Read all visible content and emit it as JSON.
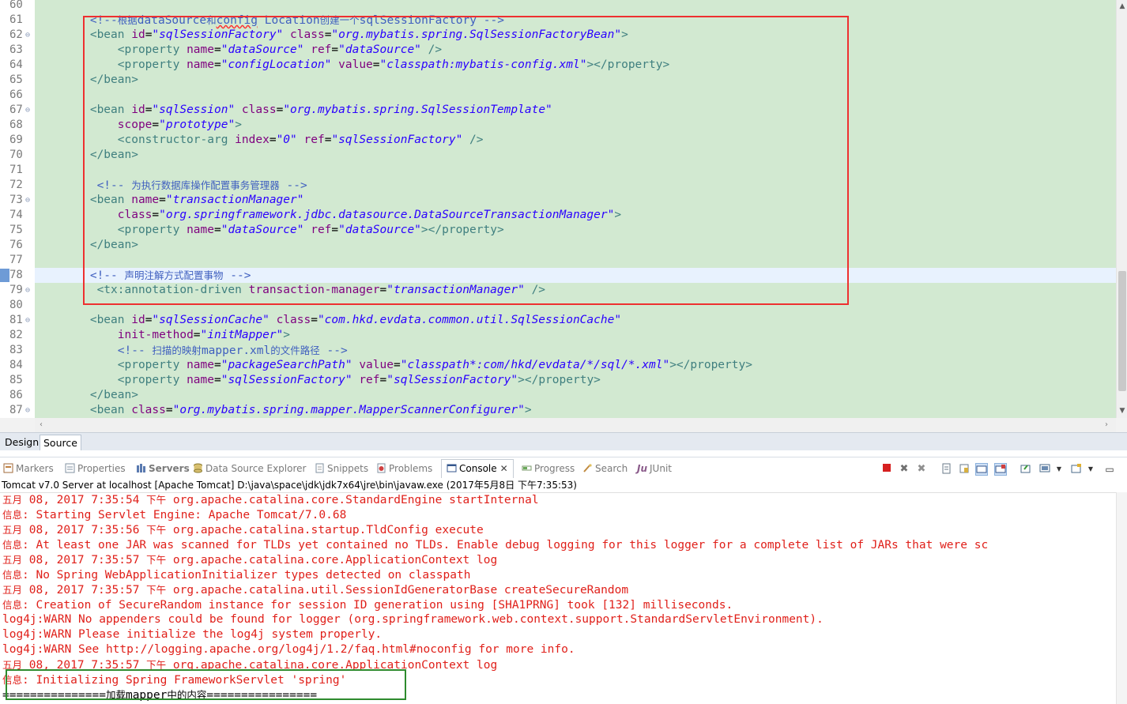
{
  "editor": {
    "gutter": [
      {
        "num": "60",
        "fold": ""
      },
      {
        "num": "61",
        "fold": ""
      },
      {
        "num": "62",
        "fold": "⊖"
      },
      {
        "num": "63",
        "fold": ""
      },
      {
        "num": "64",
        "fold": ""
      },
      {
        "num": "65",
        "fold": ""
      },
      {
        "num": "66",
        "fold": ""
      },
      {
        "num": "67",
        "fold": "⊖"
      },
      {
        "num": "68",
        "fold": ""
      },
      {
        "num": "69",
        "fold": ""
      },
      {
        "num": "70",
        "fold": ""
      },
      {
        "num": "71",
        "fold": ""
      },
      {
        "num": "72",
        "fold": ""
      },
      {
        "num": "73",
        "fold": "⊖"
      },
      {
        "num": "74",
        "fold": ""
      },
      {
        "num": "75",
        "fold": ""
      },
      {
        "num": "76",
        "fold": ""
      },
      {
        "num": "77",
        "fold": ""
      },
      {
        "num": "78",
        "fold": ""
      },
      {
        "num": "79",
        "fold": "⊖"
      },
      {
        "num": "80",
        "fold": ""
      },
      {
        "num": "81",
        "fold": "⊖"
      },
      {
        "num": "82",
        "fold": ""
      },
      {
        "num": "83",
        "fold": ""
      },
      {
        "num": "84",
        "fold": ""
      },
      {
        "num": "85",
        "fold": ""
      },
      {
        "num": "86",
        "fold": ""
      },
      {
        "num": "87",
        "fold": "⊖"
      }
    ],
    "current_line": "78",
    "code_lines": [
      [],
      [
        [
          "t",
          "        "
        ],
        [
          "c",
          "<!--"
        ],
        [
          "cz",
          "根据"
        ],
        [
          "c",
          "dataSource"
        ],
        [
          "cz",
          "和"
        ],
        [
          "sq",
          "config"
        ],
        [
          "c",
          " Location"
        ],
        [
          "cz",
          "创建一个"
        ],
        [
          "c",
          "sqlSessionFactory -->"
        ]
      ],
      [
        [
          "t",
          "        <bean "
        ],
        [
          "a",
          "id"
        ],
        [
          "e",
          "="
        ],
        [
          "v",
          "\"sqlSessionFactory\""
        ],
        [
          "t",
          " "
        ],
        [
          "a",
          "class"
        ],
        [
          "e",
          "="
        ],
        [
          "v",
          "\"org.mybatis.spring.SqlSessionFactoryBean\""
        ],
        [
          "t",
          ">"
        ]
      ],
      [
        [
          "t",
          "            <property "
        ],
        [
          "a",
          "name"
        ],
        [
          "e",
          "="
        ],
        [
          "v",
          "\"dataSource\""
        ],
        [
          "t",
          " "
        ],
        [
          "a",
          "ref"
        ],
        [
          "e",
          "="
        ],
        [
          "v",
          "\"dataSource\""
        ],
        [
          "t",
          " />"
        ]
      ],
      [
        [
          "t",
          "            <property "
        ],
        [
          "a",
          "name"
        ],
        [
          "e",
          "="
        ],
        [
          "v",
          "\"configLocation\""
        ],
        [
          "t",
          " "
        ],
        [
          "a",
          "value"
        ],
        [
          "e",
          "="
        ],
        [
          "v",
          "\"classpath:mybatis-config.xml\""
        ],
        [
          "t",
          "></property>"
        ]
      ],
      [
        [
          "t",
          "        </bean>"
        ]
      ],
      [],
      [
        [
          "t",
          "        <bean "
        ],
        [
          "a",
          "id"
        ],
        [
          "e",
          "="
        ],
        [
          "v",
          "\"sqlSession\""
        ],
        [
          "t",
          " "
        ],
        [
          "a",
          "class"
        ],
        [
          "e",
          "="
        ],
        [
          "v",
          "\"org.mybatis.spring.SqlSessionTemplate\""
        ]
      ],
      [
        [
          "t",
          "            "
        ],
        [
          "a",
          "scope"
        ],
        [
          "e",
          "="
        ],
        [
          "v",
          "\"prototype\""
        ],
        [
          "t",
          ">"
        ]
      ],
      [
        [
          "t",
          "            <constructor-arg "
        ],
        [
          "a",
          "index"
        ],
        [
          "e",
          "="
        ],
        [
          "v",
          "\"0\""
        ],
        [
          "t",
          " "
        ],
        [
          "a",
          "ref"
        ],
        [
          "e",
          "="
        ],
        [
          "v",
          "\"sqlSessionFactory\""
        ],
        [
          "t",
          " />"
        ]
      ],
      [
        [
          "t",
          "        </bean>"
        ]
      ],
      [],
      [
        [
          "t",
          "         "
        ],
        [
          "c",
          "<!-- "
        ],
        [
          "cz",
          "为执行数据库操作配置事务管理器"
        ],
        [
          "c",
          " -->"
        ]
      ],
      [
        [
          "t",
          "        <bean "
        ],
        [
          "a",
          "name"
        ],
        [
          "e",
          "="
        ],
        [
          "v",
          "\"transactionManager\""
        ]
      ],
      [
        [
          "t",
          "            "
        ],
        [
          "a",
          "class"
        ],
        [
          "e",
          "="
        ],
        [
          "v",
          "\"org.springframework.jdbc.datasource.DataSourceTransactionManager\""
        ],
        [
          "t",
          ">"
        ]
      ],
      [
        [
          "t",
          "            <property "
        ],
        [
          "a",
          "name"
        ],
        [
          "e",
          "="
        ],
        [
          "v",
          "\"dataSource\""
        ],
        [
          "t",
          " "
        ],
        [
          "a",
          "ref"
        ],
        [
          "e",
          "="
        ],
        [
          "v",
          "\"dataSource\""
        ],
        [
          "t",
          "></property>"
        ]
      ],
      [
        [
          "t",
          "        </bean>"
        ]
      ],
      [],
      [
        [
          "t",
          "        "
        ],
        [
          "c",
          "<!-- "
        ],
        [
          "cz",
          "声明注解方式配置事物"
        ],
        [
          "c",
          " -->"
        ]
      ],
      [
        [
          "t",
          "         <tx:annotation-driven "
        ],
        [
          "a",
          "transaction-manager"
        ],
        [
          "e",
          "="
        ],
        [
          "v",
          "\"transactionManager\""
        ],
        [
          "t",
          " />"
        ]
      ],
      [],
      [
        [
          "t",
          "        <bean "
        ],
        [
          "a",
          "id"
        ],
        [
          "e",
          "="
        ],
        [
          "v",
          "\"sqlSessionCache\""
        ],
        [
          "t",
          " "
        ],
        [
          "a",
          "class"
        ],
        [
          "e",
          "="
        ],
        [
          "v",
          "\"com.hkd.evdata.common.util.SqlSessionCache\""
        ]
      ],
      [
        [
          "t",
          "            "
        ],
        [
          "a",
          "init-method"
        ],
        [
          "e",
          "="
        ],
        [
          "v",
          "\"initMapper\""
        ],
        [
          "t",
          ">"
        ]
      ],
      [
        [
          "t",
          "            "
        ],
        [
          "c",
          "<!-- "
        ],
        [
          "cz",
          "扫描的映射"
        ],
        [
          "c",
          "mapper.xml"
        ],
        [
          "cz",
          "的文件路径"
        ],
        [
          "c",
          " -->"
        ]
      ],
      [
        [
          "t",
          "            <property "
        ],
        [
          "a",
          "name"
        ],
        [
          "e",
          "="
        ],
        [
          "v",
          "\"packageSearchPath\""
        ],
        [
          "t",
          " "
        ],
        [
          "a",
          "value"
        ],
        [
          "e",
          "="
        ],
        [
          "v",
          "\"classpath*:com/hkd/evdata/*/sql/*.xml\""
        ],
        [
          "t",
          "></property>"
        ]
      ],
      [
        [
          "t",
          "            <property "
        ],
        [
          "a",
          "name"
        ],
        [
          "e",
          "="
        ],
        [
          "v",
          "\"sqlSessionFactory\""
        ],
        [
          "t",
          " "
        ],
        [
          "a",
          "ref"
        ],
        [
          "e",
          "="
        ],
        [
          "v",
          "\"sqlSessionFactory\""
        ],
        [
          "t",
          "></property>"
        ]
      ],
      [
        [
          "t",
          "        </bean>"
        ]
      ],
      [
        [
          "t",
          "        <bean "
        ],
        [
          "a",
          "class"
        ],
        [
          "e",
          "="
        ],
        [
          "v",
          "\"org.mybatis.spring.mapper.MapperScannerConfigurer\""
        ],
        [
          "t",
          ">"
        ]
      ]
    ]
  },
  "page_tabs": {
    "design": "Design",
    "source": "Source"
  },
  "view_tabs": {
    "markers": "Markers",
    "properties": "Properties",
    "servers": "Servers",
    "data_source_explorer": "Data Source Explorer",
    "snippets": "Snippets",
    "problems": "Problems",
    "console": "Console",
    "progress": "Progress",
    "search": "Search",
    "junit": "JUnit"
  },
  "console": {
    "title": "Tomcat v7.0 Server at localhost [Apache Tomcat] D:\\java\\space\\jdk\\jdk7x64\\jre\\bin\\javaw.exe (2017年5月8日 下午7:35:53)",
    "lines": [
      [
        [
          "cz",
          "五月"
        ],
        [
          "m",
          " 08, 2017 7:35:54 "
        ],
        [
          "cz",
          "下午"
        ],
        [
          "m",
          " org.apache.catalina.core.StandardEngine startInternal"
        ]
      ],
      [
        [
          "cz",
          "信息"
        ],
        [
          "m",
          ": Starting Servlet Engine: Apache Tomcat/7.0.68"
        ]
      ],
      [
        [
          "cz",
          "五月"
        ],
        [
          "m",
          " 08, 2017 7:35:56 "
        ],
        [
          "cz",
          "下午"
        ],
        [
          "m",
          " org.apache.catalina.startup.TldConfig execute"
        ]
      ],
      [
        [
          "cz",
          "信息"
        ],
        [
          "m",
          ": At least one JAR was scanned for TLDs yet contained no TLDs. Enable debug logging for this logger for a complete list of JARs that were sc"
        ]
      ],
      [
        [
          "cz",
          "五月"
        ],
        [
          "m",
          " 08, 2017 7:35:57 "
        ],
        [
          "cz",
          "下午"
        ],
        [
          "m",
          " org.apache.catalina.core.ApplicationContext log"
        ]
      ],
      [
        [
          "cz",
          "信息"
        ],
        [
          "m",
          ": No Spring WebApplicationInitializer types detected on classpath"
        ]
      ],
      [
        [
          "cz",
          "五月"
        ],
        [
          "m",
          " 08, 2017 7:35:57 "
        ],
        [
          "cz",
          "下午"
        ],
        [
          "m",
          " org.apache.catalina.util.SessionIdGeneratorBase createSecureRandom"
        ]
      ],
      [
        [
          "cz",
          "信息"
        ],
        [
          "m",
          ": Creation of SecureRandom instance for session ID generation using [SHA1PRNG] took [132] milliseconds."
        ]
      ],
      [
        [
          "m",
          "log4j:WARN No appenders could be found for logger (org.springframework.web.context.support.StandardServletEnvironment)."
        ]
      ],
      [
        [
          "m",
          "log4j:WARN Please initialize the log4j system properly."
        ]
      ],
      [
        [
          "m",
          "log4j:WARN See http://logging.apache.org/log4j/1.2/faq.html#noconfig for more info."
        ]
      ],
      [
        [
          "cz",
          "五月"
        ],
        [
          "m",
          " 08, 2017 7:35:57 "
        ],
        [
          "cz",
          "下午"
        ],
        [
          "m",
          " org.apache.catalina.core.ApplicationContext log"
        ]
      ],
      [
        [
          "cz",
          "信息"
        ],
        [
          "m",
          ": Initializing Spring FrameworkServlet 'spring'"
        ]
      ],
      [
        [
          "m",
          "==============="
        ],
        [
          "cz",
          "加载"
        ],
        [
          "m",
          "mapper"
        ],
        [
          "cz",
          "中的内容"
        ],
        [
          "m",
          "================"
        ]
      ]
    ],
    "black_lines": [
      13
    ]
  },
  "colors": {
    "editor_bg": "#d2e9d1",
    "tag": "#3f7f7f",
    "attribute": "#7f007f",
    "value": "#2a00ff",
    "comment": "#3f5fbf",
    "console_error": "#e0201a",
    "highlight_red": "#ee3030",
    "highlight_green": "#2e8b2e"
  }
}
